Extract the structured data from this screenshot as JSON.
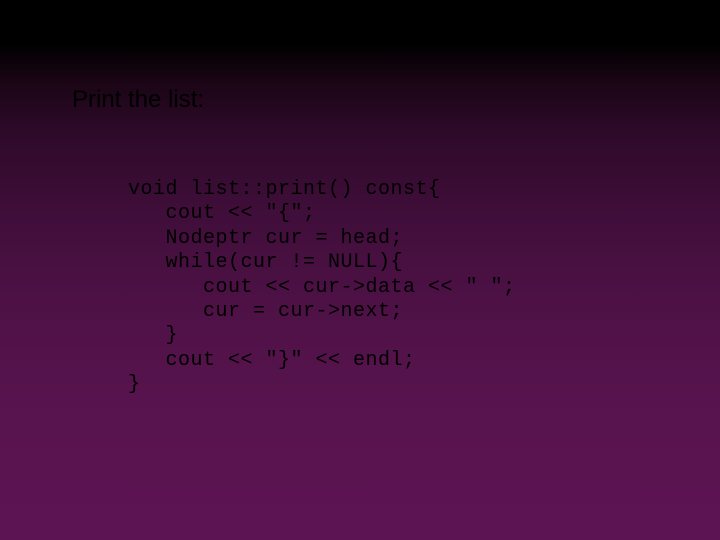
{
  "title": "Print the list:",
  "code": {
    "l1": "void list::print() const{",
    "l2": "   cout << \"{\";",
    "l3": "   Nodeptr cur = head;",
    "l4": "   while(cur != NULL){",
    "l5": "      cout << cur->data << \" \";",
    "l6": "      cur = cur->next;",
    "l7": "   }",
    "l8": "   cout << \"}\" << endl;",
    "l9": "}"
  }
}
